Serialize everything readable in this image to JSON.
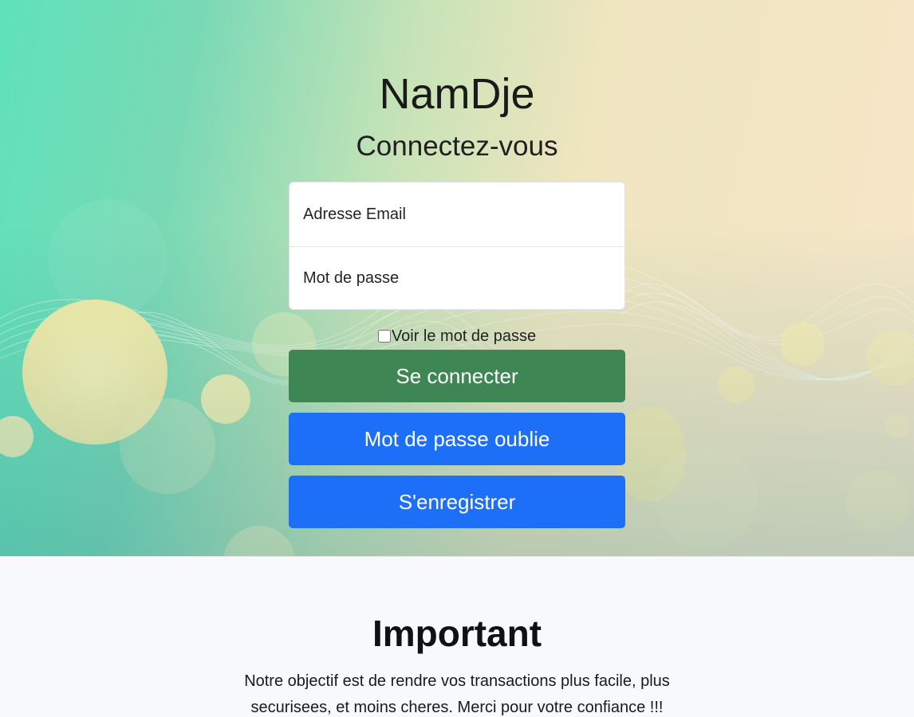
{
  "app": {
    "title": "NamDje",
    "subtitle": "Connectez-vous"
  },
  "login_form": {
    "email_placeholder": "Adresse Email",
    "password_placeholder": "Mot de passe",
    "show_password_label": "Voir le mot de passe",
    "show_password_checked": false
  },
  "buttons": {
    "login_label": "Se connecter",
    "forgot_password_label": "Mot de passe oublie",
    "register_label": "S'enregistrer"
  },
  "info_section": {
    "heading": "Important",
    "text": "Notre objectif est de rendre vos transactions plus facile, plus securisees, et moins cheres. Merci pour votre confiance !!!"
  },
  "colors": {
    "login_button": "#3e8654",
    "primary_button": "#1e6ff7",
    "info_background": "#f8f9fa"
  }
}
